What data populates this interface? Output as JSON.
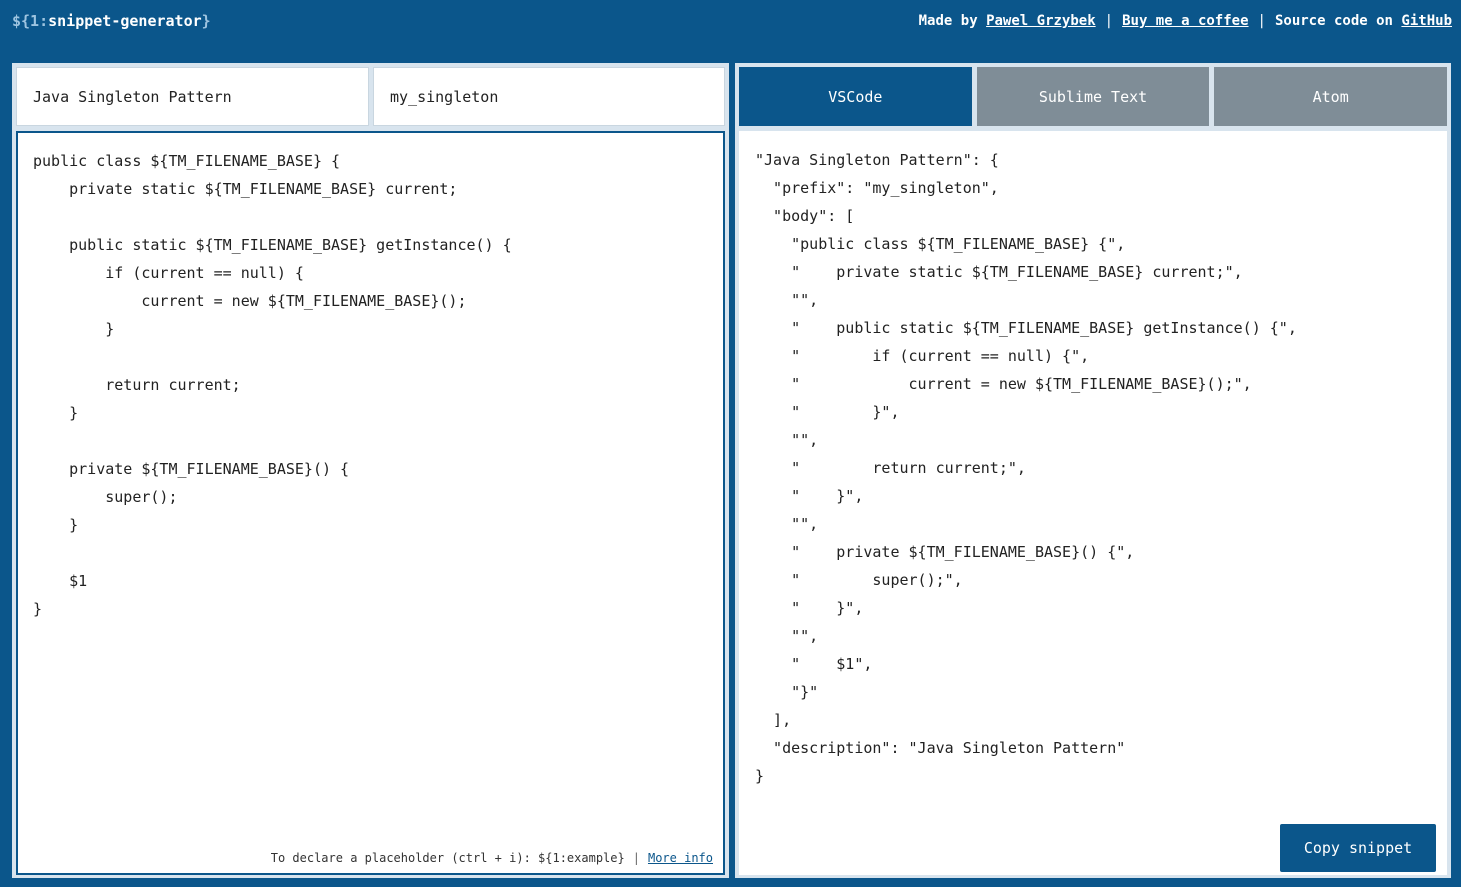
{
  "header": {
    "logo_prefix": "${1:",
    "logo_name": "snippet-generator",
    "logo_suffix": "}",
    "made_by_text": "Made by",
    "author_link": "Pawel Grzybek",
    "sep": "|",
    "coffee_link": "Buy me a coffee",
    "source_text": "Source code on",
    "github_link": "GitHub"
  },
  "inputs": {
    "description_value": "Java Singleton Pattern",
    "prefix_value": "my_singleton"
  },
  "editor": {
    "code": "public class ${TM_FILENAME_BASE} {\n    private static ${TM_FILENAME_BASE} current;\n\n    public static ${TM_FILENAME_BASE} getInstance() {\n        if (current == null) {\n            current = new ${TM_FILENAME_BASE}();\n        }\n\n        return current;\n    }\n\n    private ${TM_FILENAME_BASE}() {\n        super();\n    }\n\n    $1\n}",
    "hint_text": "To declare a placeholder (ctrl + i): ${1:example}",
    "hint_sep": "|",
    "more_info_link": "More info"
  },
  "tabs": [
    {
      "label": "VSCode",
      "active": true
    },
    {
      "label": "Sublime Text",
      "active": false
    },
    {
      "label": "Atom",
      "active": false
    }
  ],
  "output": {
    "code": "\"Java Singleton Pattern\": {\n  \"prefix\": \"my_singleton\",\n  \"body\": [\n    \"public class ${TM_FILENAME_BASE} {\",\n    \"    private static ${TM_FILENAME_BASE} current;\",\n    \"\",\n    \"    public static ${TM_FILENAME_BASE} getInstance() {\",\n    \"        if (current == null) {\",\n    \"            current = new ${TM_FILENAME_BASE}();\",\n    \"        }\",\n    \"\",\n    \"        return current;\",\n    \"    }\",\n    \"\",\n    \"    private ${TM_FILENAME_BASE}() {\",\n    \"        super();\",\n    \"    }\",\n    \"\",\n    \"    $1\",\n    \"}\"\n  ],\n  \"description\": \"Java Singleton Pattern\"\n}",
    "copy_button": "Copy snippet"
  },
  "colors": {
    "brand": "#0b568b",
    "tab_inactive": "#7f8d97",
    "panel_bg": "#d8e4ee"
  }
}
